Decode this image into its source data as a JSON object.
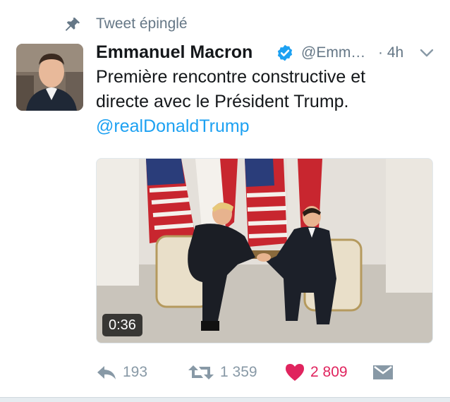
{
  "pinned": {
    "label": "Tweet épinglé",
    "icon": "pin-icon"
  },
  "author": {
    "name": "Emmanuel Macron",
    "verified_icon": "verified-badge-icon",
    "handle": "@Emm…",
    "time": "· 4h"
  },
  "tweet": {
    "line1": "Première rencontre constructive et",
    "line2": "directe avec le Président Trump.",
    "mention": "@realDonaldTrump"
  },
  "media": {
    "duration": "0:36"
  },
  "actions": {
    "replies": "193",
    "retweets": "1 359",
    "likes": "2 809"
  },
  "colors": {
    "accent": "#1da1f2",
    "muted": "#657786",
    "like": "#e0245e",
    "verified": "#1da1f2"
  }
}
